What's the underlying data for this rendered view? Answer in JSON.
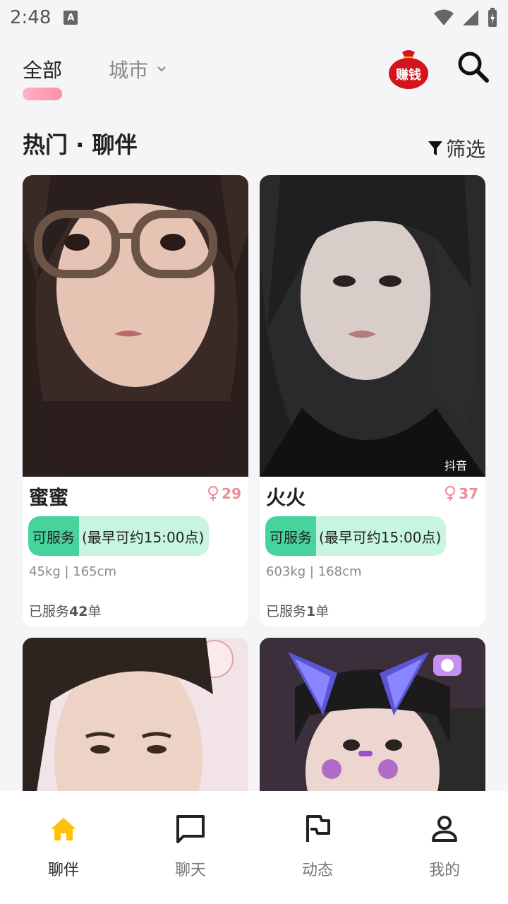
{
  "status_bar": {
    "time": "2:48",
    "notification_icon": "A"
  },
  "top_tabs": {
    "all": "全部",
    "city": "城市",
    "earn_badge": "赚钱"
  },
  "section": {
    "title": "热门 · 聊伴",
    "filter": "筛选"
  },
  "cards": [
    {
      "name": "蜜蜜",
      "age": "29",
      "service_tag": "可服务",
      "service_time": "(最早可约15:00点)",
      "stats": "45kg | 165cm",
      "served_prefix": "已服务",
      "served_count": "42",
      "served_suffix": "单"
    },
    {
      "name": "火火",
      "age": "37",
      "service_tag": "可服务",
      "service_time": "(最早可约15:00点)",
      "stats": "603kg | 168cm",
      "served_prefix": "已服务",
      "served_count": "1",
      "served_suffix": "单",
      "watermark": "抖音"
    }
  ],
  "bottom_nav": [
    {
      "label": "聊伴",
      "icon": "home-icon",
      "active": true
    },
    {
      "label": "聊天",
      "icon": "chat-icon",
      "active": false
    },
    {
      "label": "动态",
      "icon": "flag-icon",
      "active": false
    },
    {
      "label": "我的",
      "icon": "person-icon",
      "active": false
    }
  ],
  "colors": {
    "accent_pink": "#ff8fa8",
    "service_green": "#46d39c",
    "service_bg": "#c8f5e0",
    "active_nav": "#ffc107"
  }
}
